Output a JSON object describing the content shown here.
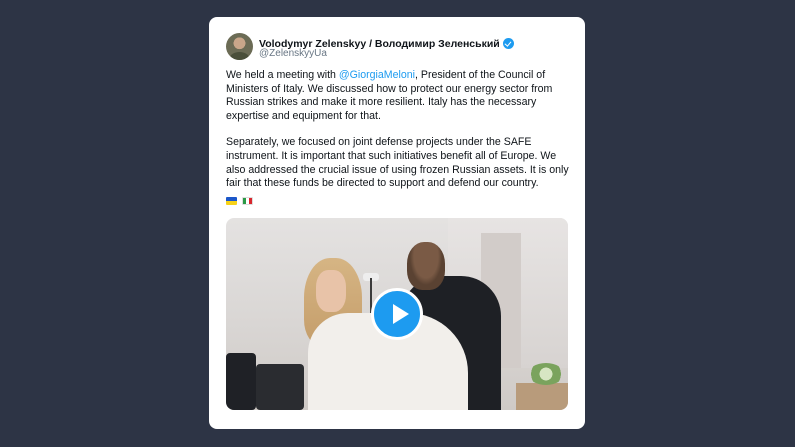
{
  "tweet": {
    "author_name": "Volodymyr Zelenskyy / Володимир Зеленський",
    "handle": "@ZelenskyyUa",
    "verified": true,
    "paragraph1_before": "We held a meeting with ",
    "mention": "@GiorgiaMeloni",
    "paragraph1_after": ", President of the Council of Ministers of Italy. We discussed how to protect our energy sector from Russian strikes and make it more resilient. Italy has the necessary expertise and equipment for that.",
    "paragraph2": "Separately, we focused on joint defense projects under the SAFE instrument. It is important that such initiatives benefit all of Europe. We also addressed the crucial issue of using frozen Russian assets. It is only fair that these funds be directed to support and defend our country.",
    "flags": [
      "flag-ukraine-icon",
      "flag-italy-icon"
    ],
    "media": {
      "type": "video",
      "icon": "play-icon"
    }
  },
  "colors": {
    "background": "#2d3445",
    "card": "#ffffff",
    "link": "#1d9bf0",
    "text": "#0f1419",
    "secondary_text": "#687684",
    "play_button": "#1d9bf0"
  }
}
